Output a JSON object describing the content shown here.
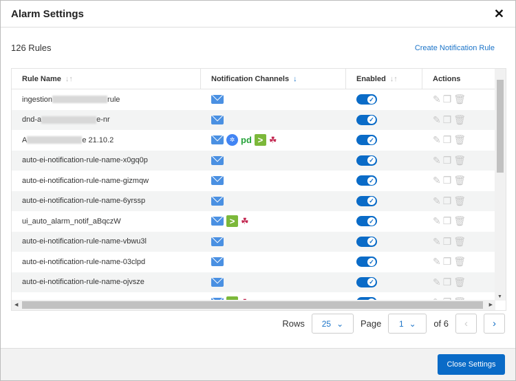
{
  "title": "Alarm Settings",
  "rule_count": "126 Rules",
  "create_link": "Create Notification Rule",
  "columns": {
    "name": "Rule Name",
    "channels": "Notification Channels",
    "enabled": "Enabled",
    "actions": "Actions"
  },
  "rows": [
    {
      "pre": "ingestion",
      "post": "rule",
      "blur": true,
      "channels": [
        "email"
      ],
      "enabled": true
    },
    {
      "pre": "dnd-a",
      "post": "e-nr",
      "blur": true,
      "channels": [
        "email"
      ],
      "enabled": true
    },
    {
      "pre": "A",
      "post": "e 21.10.2",
      "blur": true,
      "channels": [
        "email",
        "google-cloud",
        "pagerduty",
        "shell",
        "webhook"
      ],
      "enabled": true
    },
    {
      "pre": "auto-ei-notification-rule-name-x0gq0p",
      "channels": [
        "email"
      ],
      "enabled": true
    },
    {
      "pre": "auto-ei-notification-rule-name-gizmqw",
      "channels": [
        "email"
      ],
      "enabled": true
    },
    {
      "pre": "auto-ei-notification-rule-name-6yrssp",
      "channels": [
        "email"
      ],
      "enabled": true
    },
    {
      "pre": "ui_auto_alarm_notif_aBqczW",
      "channels": [
        "email",
        "shell",
        "webhook"
      ],
      "enabled": true
    },
    {
      "pre": "auto-ei-notification-rule-name-vbwu3l",
      "channels": [
        "email"
      ],
      "enabled": true
    },
    {
      "pre": "auto-ei-notification-rule-name-03clpd",
      "channels": [
        "email"
      ],
      "enabled": true
    },
    {
      "pre": "auto-ei-notification-rule-name-ojvsze",
      "channels": [
        "email"
      ],
      "enabled": true
    },
    {
      "pre": "",
      "channels": [
        "email",
        "shell",
        "webhook"
      ],
      "enabled": true
    }
  ],
  "pagination": {
    "rows_label": "Rows",
    "rows_value": "25",
    "page_label": "Page",
    "page_value": "1",
    "of": "of 6"
  },
  "close_button": "Close Settings"
}
